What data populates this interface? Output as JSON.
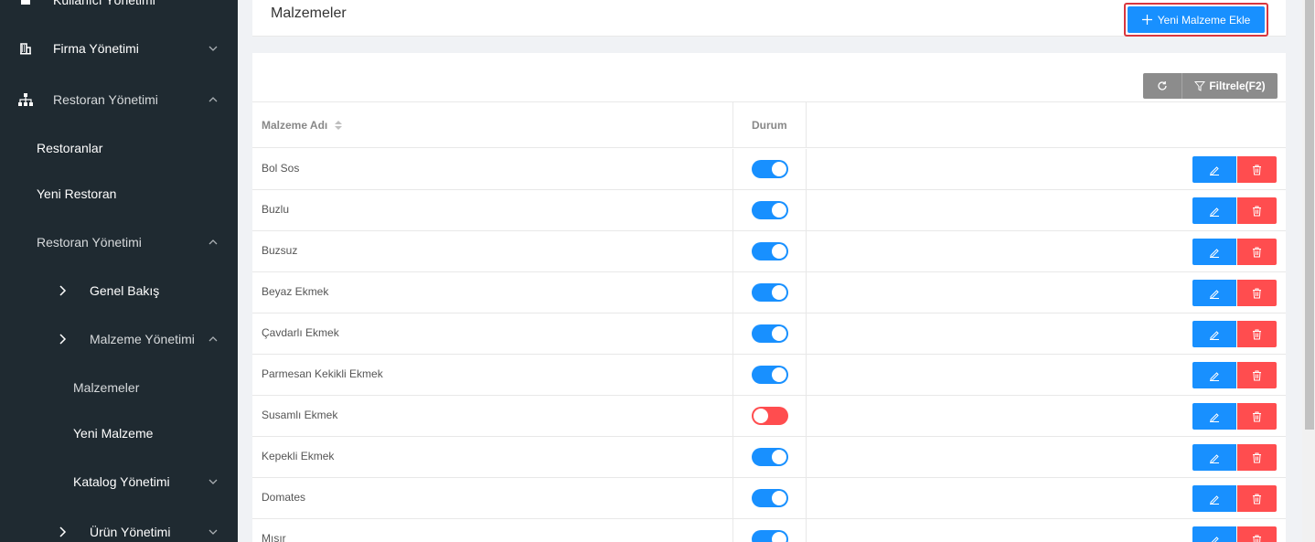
{
  "sidebar": {
    "items": [
      {
        "label": "Kullanıcı Yönetimi"
      },
      {
        "label": "Firma Yönetimi"
      },
      {
        "label": "Restoran Yönetimi"
      },
      {
        "label": "Restoranlar"
      },
      {
        "label": "Yeni Restoran"
      },
      {
        "label": "Restoran Yönetimi"
      },
      {
        "label": "Genel Bakış"
      },
      {
        "label": "Malzeme Yönetimi"
      },
      {
        "label": "Malzemeler"
      },
      {
        "label": "Yeni Malzeme"
      },
      {
        "label": "Katalog Yönetimi"
      },
      {
        "label": "Ürün Yönetimi"
      }
    ]
  },
  "header": {
    "title": "Malzemeler",
    "add_label": "Yeni Malzeme Ekle"
  },
  "toolbar": {
    "filter_label": "Filtrele(F2)"
  },
  "table": {
    "columns": [
      "Malzeme Adı",
      "Durum"
    ],
    "rows": [
      {
        "name": "Bol Sos",
        "active": true
      },
      {
        "name": "Buzlu",
        "active": true
      },
      {
        "name": "Buzsuz",
        "active": true
      },
      {
        "name": "Beyaz Ekmek",
        "active": true
      },
      {
        "name": "Çavdarlı Ekmek",
        "active": true
      },
      {
        "name": "Parmesan Kekikli Ekmek",
        "active": true
      },
      {
        "name": "Susamlı Ekmek",
        "active": false
      },
      {
        "name": "Kepekli Ekmek",
        "active": true
      },
      {
        "name": "Domates",
        "active": true
      },
      {
        "name": "Mısır",
        "active": true
      }
    ]
  },
  "colors": {
    "sidebar_bg": "#1f2a31",
    "primary": "#1890ff",
    "danger": "#ff4d4f",
    "highlight_border": "#d9363e"
  }
}
